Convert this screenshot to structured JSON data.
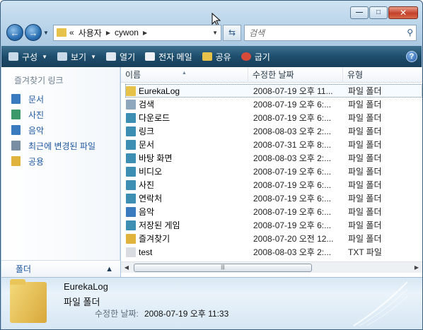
{
  "window": {
    "caption_buttons": [
      "minimize",
      "maximize",
      "close"
    ]
  },
  "navigation": {
    "back_icon": "back-arrow-icon",
    "forward_icon": "forward-arrow-icon",
    "breadcrumb_prefix": "«",
    "breadcrumbs": [
      "사용자",
      "cywon"
    ]
  },
  "search": {
    "placeholder": "검색"
  },
  "toolbar": {
    "organize": "구성",
    "views": "보기",
    "open": "열기",
    "email": "전자 메일",
    "share": "공유",
    "burn": "굽기"
  },
  "favorites": {
    "title": "즐겨찾기 링크",
    "items": [
      {
        "label": "문서",
        "icon": "documents-icon",
        "color": "#3a7bbf"
      },
      {
        "label": "사진",
        "icon": "pictures-icon",
        "color": "#3c9a6a"
      },
      {
        "label": "음악",
        "icon": "music-icon",
        "color": "#3a7bbf"
      },
      {
        "label": "최근에 변경된 파일",
        "icon": "recent-files-icon",
        "color": "#7a8ea3"
      },
      {
        "label": "공용",
        "icon": "public-folder-icon",
        "color": "#e0b43c"
      }
    ],
    "folders_label": "폴더"
  },
  "columns": {
    "name": "이름",
    "modified": "수정한 날짜",
    "type": "유형"
  },
  "files": [
    {
      "name": "EurekaLog",
      "date": "2008-07-19 오후 11...",
      "type": "파일 폴더",
      "icon_color": "#e7c24a",
      "selected": true
    },
    {
      "name": "검색",
      "date": "2008-07-19 오후 6:...",
      "type": "파일 폴더",
      "icon_color": "#8fa7bd",
      "selected": false
    },
    {
      "name": "다운로드",
      "date": "2008-07-19 오후 6:...",
      "type": "파일 폴더",
      "icon_color": "#3c8fb2",
      "selected": false
    },
    {
      "name": "링크",
      "date": "2008-08-03 오후 2:...",
      "type": "파일 폴더",
      "icon_color": "#3c8fb2",
      "selected": false
    },
    {
      "name": "문서",
      "date": "2008-07-31 오후 8:...",
      "type": "파일 폴더",
      "icon_color": "#3c8fb2",
      "selected": false
    },
    {
      "name": "바탕 화면",
      "date": "2008-08-03 오후 2:...",
      "type": "파일 폴더",
      "icon_color": "#3c8fb2",
      "selected": false
    },
    {
      "name": "비디오",
      "date": "2008-07-19 오후 6:...",
      "type": "파일 폴더",
      "icon_color": "#3c8fb2",
      "selected": false
    },
    {
      "name": "사진",
      "date": "2008-07-19 오후 6:...",
      "type": "파일 폴더",
      "icon_color": "#3c8fb2",
      "selected": false
    },
    {
      "name": "연락처",
      "date": "2008-07-19 오후 6:...",
      "type": "파일 폴더",
      "icon_color": "#3c8fb2",
      "selected": false
    },
    {
      "name": "음악",
      "date": "2008-07-19 오후 6:...",
      "type": "파일 폴더",
      "icon_color": "#3a7bbf",
      "selected": false
    },
    {
      "name": "저장된 게임",
      "date": "2008-07-19 오후 6:...",
      "type": "파일 폴더",
      "icon_color": "#3c8fb2",
      "selected": false
    },
    {
      "name": "즐겨찾기",
      "date": "2008-07-20 오전 12...",
      "type": "파일 폴더",
      "icon_color": "#e0b43c",
      "selected": false
    },
    {
      "name": "test",
      "date": "2008-08-03 오후 2:...",
      "type": "TXT 파일",
      "icon_color": "#d9dde2",
      "selected": false
    }
  ],
  "details": {
    "name": "EurekaLog",
    "type": "파일 폴더",
    "modified_label": "수정한 날짜:",
    "modified_value": "2008-07-19 오후 11:33"
  }
}
